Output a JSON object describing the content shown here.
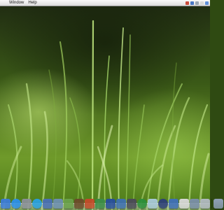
{
  "menubar": {
    "items": [
      "Window",
      "Help"
    ]
  },
  "status_icons": [
    {
      "name": "status-icon-1",
      "color": "#c94b3a"
    },
    {
      "name": "status-icon-2",
      "color": "#4a78c4"
    },
    {
      "name": "status-icon-3",
      "color": "#9aa6b2"
    },
    {
      "name": "status-icon-4",
      "color": "#d8d8d8"
    },
    {
      "name": "status-icon-5",
      "color": "#5f8fd8"
    }
  ],
  "dock": {
    "apps": [
      {
        "name": "finder-icon",
        "color": "#3b7bd8",
        "round": false
      },
      {
        "name": "safari-icon",
        "color": "#2b8ee8",
        "round": true
      },
      {
        "name": "system-preferences-icon",
        "color": "#8a8f98",
        "round": false
      },
      {
        "name": "itunes-icon",
        "color": "#2aa0e0",
        "round": true
      },
      {
        "name": "mail-icon",
        "color": "#4a6fb5",
        "round": false
      },
      {
        "name": "preview-icon",
        "color": "#6d8fb0",
        "round": false
      },
      {
        "name": "photos-icon",
        "color": "#6aa04a",
        "round": false
      },
      {
        "name": "dictionary-icon",
        "color": "#6b4a2a",
        "round": false
      },
      {
        "name": "app-icon-9",
        "color": "#c24a2a",
        "round": false
      },
      {
        "name": "app-icon-10",
        "color": "#3b8c48",
        "round": false
      },
      {
        "name": "app-icon-11",
        "color": "#274e9c",
        "round": false
      },
      {
        "name": "app-icon-12",
        "color": "#3d6fb0",
        "round": false
      },
      {
        "name": "app-icon-13",
        "color": "#4a4a58",
        "round": false
      },
      {
        "name": "app-icon-14",
        "color": "#2b8f3b",
        "round": true
      },
      {
        "name": "app-icon-15",
        "color": "#a8c8d8",
        "round": false
      },
      {
        "name": "app-icon-16",
        "color": "#2c3f78",
        "round": true
      },
      {
        "name": "app-icon-17",
        "color": "#3f6fb8",
        "round": false
      },
      {
        "name": "app-icon-18",
        "color": "#d8d8d8",
        "round": false
      },
      {
        "name": "app-icon-19",
        "color": "#7a8ea8",
        "round": false
      },
      {
        "name": "app-icon-20",
        "color": "#b0b8c0",
        "round": false
      }
    ],
    "right": [
      {
        "name": "downloads-stack-icon",
        "color": "#8fa0b8",
        "round": false
      },
      {
        "name": "trash-icon",
        "color": "#c8ccd0",
        "round": false
      }
    ]
  }
}
